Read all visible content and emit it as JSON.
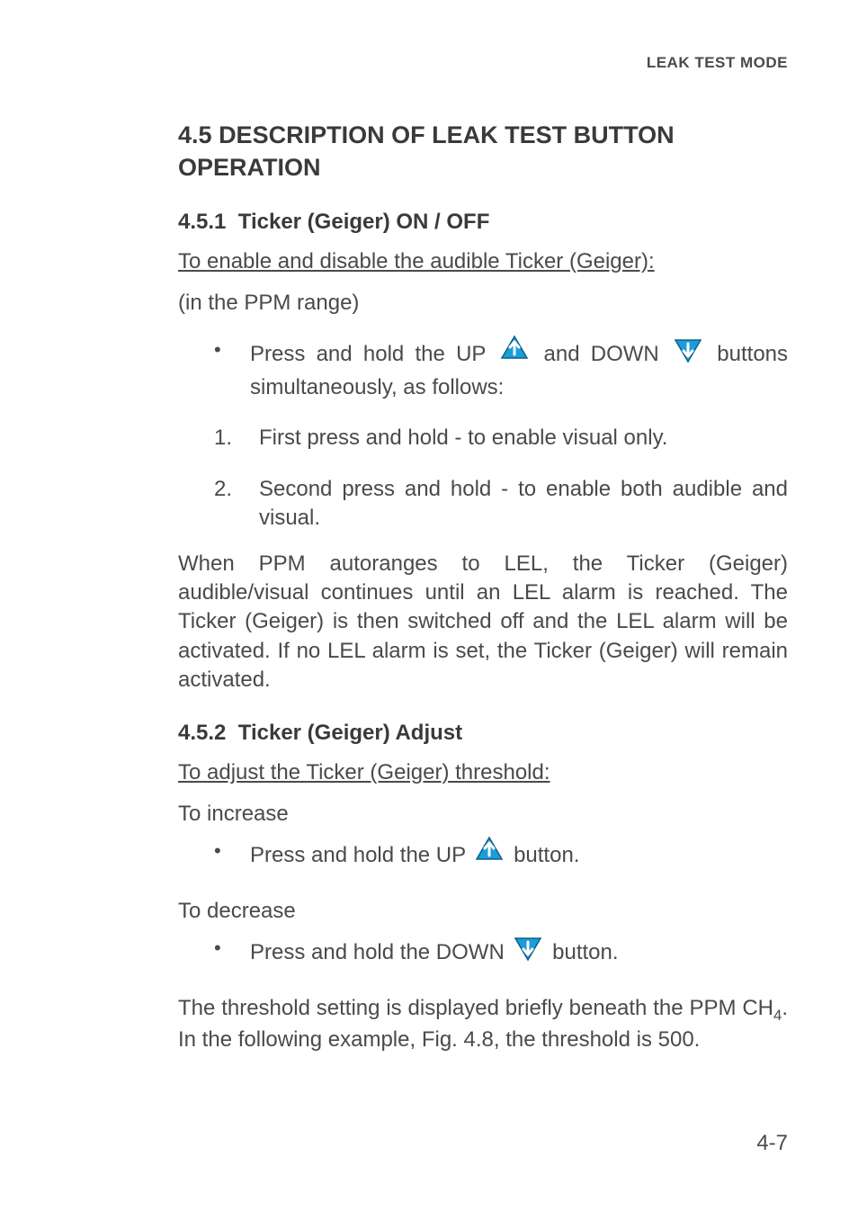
{
  "runningHead": "LEAK TEST MODE",
  "section": {
    "number": "4.5",
    "title": "DESCRIPTION OF LEAK TEST BUTTON OPERATION"
  },
  "s451": {
    "heading_num": "4.5.1",
    "heading_text": "Ticker (Geiger) ON / OFF",
    "lead": "To enable and disable the audible Ticker (Geiger):",
    "context": "(in the PPM range)",
    "bullet_pre": "Press and hold the UP",
    "bullet_mid": "and DOWN",
    "bullet_post": "buttons simultaneously, as follows:",
    "step1_num": "1.",
    "step1": "First press and hold - to enable  visual only.",
    "step2_num": "2.",
    "step2": "Second press and hold - to enable both audible and visual.",
    "after": "When PPM autoranges to LEL, the Ticker (Geiger) audible/visual continues until an LEL alarm is reached. The Ticker (Geiger) is then switched off and the LEL alarm will be activated. If no LEL alarm is set, the Ticker (Geiger) will remain activated."
  },
  "s452": {
    "heading_num": "4.5.2",
    "heading_text": "Ticker (Geiger) Adjust",
    "lead": "To adjust the Ticker (Geiger) threshold:",
    "inc_label": "To increase",
    "inc_pre": "Press and hold the UP",
    "inc_post": "button.",
    "dec_label": "To decrease",
    "dec_pre": "Press and hold the DOWN",
    "dec_post": "button.",
    "after_pre": "The threshold setting is displayed briefly beneath the PPM CH",
    "after_sub": "4",
    "after_post": ". In the following example, Fig. 4.8, the threshold is 500."
  },
  "icons": {
    "up": "up-arrow-icon",
    "down": "down-arrow-icon"
  },
  "pageNumber": "4-7"
}
